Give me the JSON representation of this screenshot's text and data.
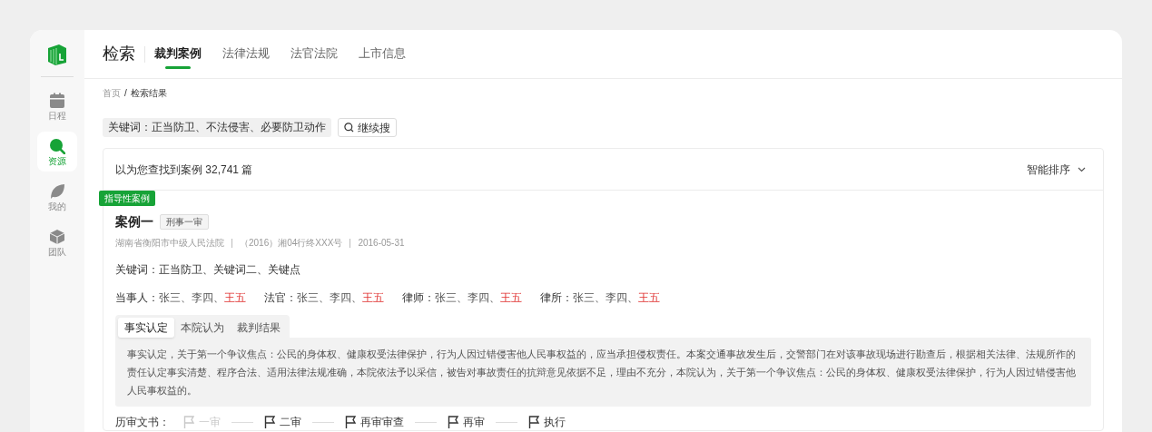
{
  "sidebar": {
    "items": [
      {
        "label": "日程",
        "selected": false
      },
      {
        "label": "资源",
        "selected": true
      },
      {
        "label": "我的",
        "selected": false
      },
      {
        "label": "团队",
        "selected": false
      }
    ]
  },
  "header": {
    "title": "检索",
    "tabs": [
      {
        "label": "裁判案例",
        "selected": true
      },
      {
        "label": "法律法规",
        "selected": false
      },
      {
        "label": "法官法院",
        "selected": false
      },
      {
        "label": "上市信息",
        "selected": false
      }
    ]
  },
  "breadcrumb": [
    {
      "label": "首页",
      "current": false
    },
    {
      "label": "检索结果",
      "current": true
    }
  ],
  "breadcrumb_separator": "/",
  "search": {
    "keywords": "关键词：正当防卫、不法侵害、必要防卫动作",
    "button": "继续搜"
  },
  "results": {
    "summary": "以为您查找到案例 32,741 篇",
    "sort": "智能排序",
    "case": {
      "ribbon": "指导性案例",
      "title": "案例一",
      "tag": "刑事一审",
      "meta": [
        "湖南省衡阳市中级人民法院",
        "（2016）湘04行终XXX号",
        "2016-05-31"
      ],
      "keywords_label": "关键词：",
      "keywords": "正当防卫、关键词二、关键点",
      "name_separator": "、",
      "parties": [
        {
          "label": "当事人：",
          "names": [
            {
              "text": "张三",
              "highlight": false
            },
            {
              "text": "李四",
              "highlight": false
            },
            {
              "text": "王五",
              "highlight": true
            }
          ]
        },
        {
          "label": "法官：",
          "names": [
            {
              "text": "张三",
              "highlight": false
            },
            {
              "text": "李四",
              "highlight": false
            },
            {
              "text": "王五",
              "highlight": true
            }
          ]
        },
        {
          "label": "律师：",
          "names": [
            {
              "text": "张三",
              "highlight": false
            },
            {
              "text": "李四",
              "highlight": false
            },
            {
              "text": "王五",
              "highlight": true
            }
          ]
        },
        {
          "label": "律所：",
          "names": [
            {
              "text": "张三",
              "highlight": false
            },
            {
              "text": "李四",
              "highlight": false
            },
            {
              "text": "王五",
              "highlight": true
            }
          ]
        }
      ],
      "tabs": [
        {
          "label": "事实认定",
          "selected": true
        },
        {
          "label": "本院认为",
          "selected": false
        },
        {
          "label": "裁判结果",
          "selected": false
        }
      ],
      "text": "事实认定，关于第一个争议焦点：公民的身体权、健康权受法律保护，行为人因过错侵害他人民事权益的，应当承担侵权责任。本案交通事故发生后，交警部门在对该事故现场进行勘查后，根据相关法律、法规所作的责任认定事实清楚、程序合法、适用法律法规准确，本院依法予以采信，被告对事故责任的抗辩意见依据不足，理由不充分，本院认为，关于第一个争议焦点：公民的身体权、健康权受法律保护，行为人因过错侵害他人民事权益的。",
      "history_label": "历审文书：",
      "history": [
        {
          "label": "一审",
          "disabled": true
        },
        {
          "label": "二审",
          "disabled": false
        },
        {
          "label": "再审审查",
          "disabled": false
        },
        {
          "label": "再审",
          "disabled": false
        },
        {
          "label": "执行",
          "disabled": false
        }
      ]
    }
  }
}
